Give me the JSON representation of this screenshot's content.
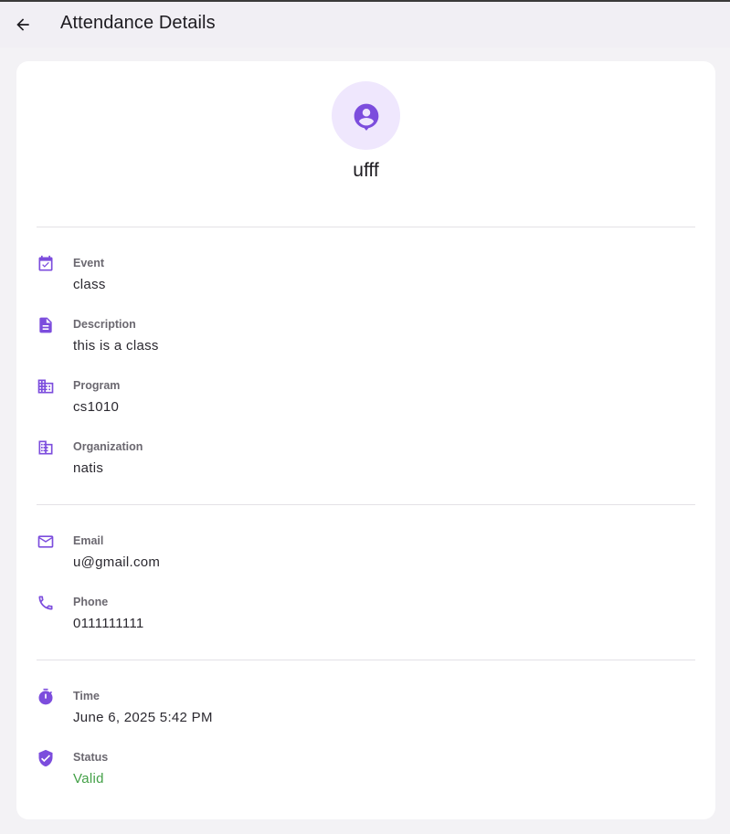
{
  "appbar": {
    "title": "Attendance Details",
    "back_icon": "arrow-back-icon"
  },
  "profile": {
    "name": "ufff",
    "avatar_icon": "person-pin-icon"
  },
  "details": {
    "event": {
      "label": "Event",
      "value": "class",
      "icon": "calendar-check-icon"
    },
    "description": {
      "label": "Description",
      "value": "this is a class",
      "icon": "document-icon"
    },
    "program": {
      "label": "Program",
      "value": "cs1010",
      "icon": "building-icon"
    },
    "organization": {
      "label": "Organization",
      "value": "natis",
      "icon": "corporate-icon"
    }
  },
  "contact": {
    "email": {
      "label": "Email",
      "value": "u@gmail.com",
      "icon": "mail-icon"
    },
    "phone": {
      "label": "Phone",
      "value": "0111111111",
      "icon": "phone-icon"
    }
  },
  "attendance": {
    "time": {
      "label": "Time",
      "value": "June 6, 2025 5:42 PM",
      "icon": "timer-icon"
    },
    "status": {
      "label": "Status",
      "value": "Valid",
      "icon": "verified-shield-icon"
    }
  },
  "colors": {
    "accent": "#7c4ddd",
    "avatar_bg": "#efe7fd",
    "status_valid": "#43a047",
    "page_bg": "#f3f2f5",
    "card_bg": "#ffffff"
  }
}
